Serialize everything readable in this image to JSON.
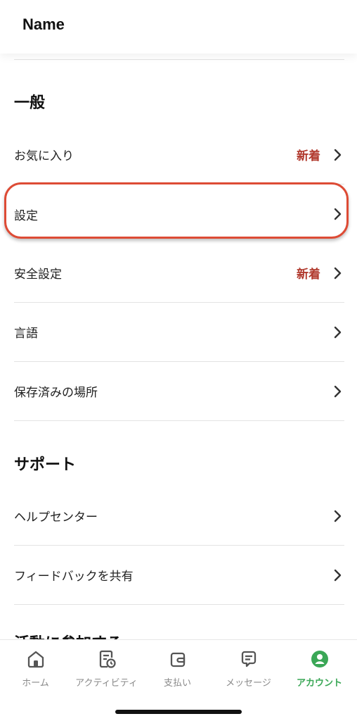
{
  "header": {
    "title": "Name"
  },
  "general": {
    "title": "一般",
    "items": [
      {
        "label": "お気に入り",
        "badge": "新着"
      },
      {
        "label": "設定",
        "badge": ""
      },
      {
        "label": "安全設定",
        "badge": "新着"
      },
      {
        "label": "言語",
        "badge": ""
      },
      {
        "label": "保存済みの場所",
        "badge": ""
      }
    ]
  },
  "support": {
    "title": "サポート",
    "items": [
      {
        "label": "ヘルプセンター"
      },
      {
        "label": "フィードバックを共有"
      }
    ]
  },
  "next_section_partial": "活動に参加する",
  "tabbar": {
    "tabs": [
      {
        "label": "ホーム",
        "icon": "home-icon"
      },
      {
        "label": "アクティビティ",
        "icon": "activity-icon"
      },
      {
        "label": "支払い",
        "icon": "wallet-icon"
      },
      {
        "label": "メッセージ",
        "icon": "message-icon"
      },
      {
        "label": "アカウント",
        "icon": "account-icon",
        "active": true
      }
    ]
  },
  "colors": {
    "badge": "#b13a2e",
    "active_tab": "#3aa756",
    "highlight": "#dd4b35"
  }
}
